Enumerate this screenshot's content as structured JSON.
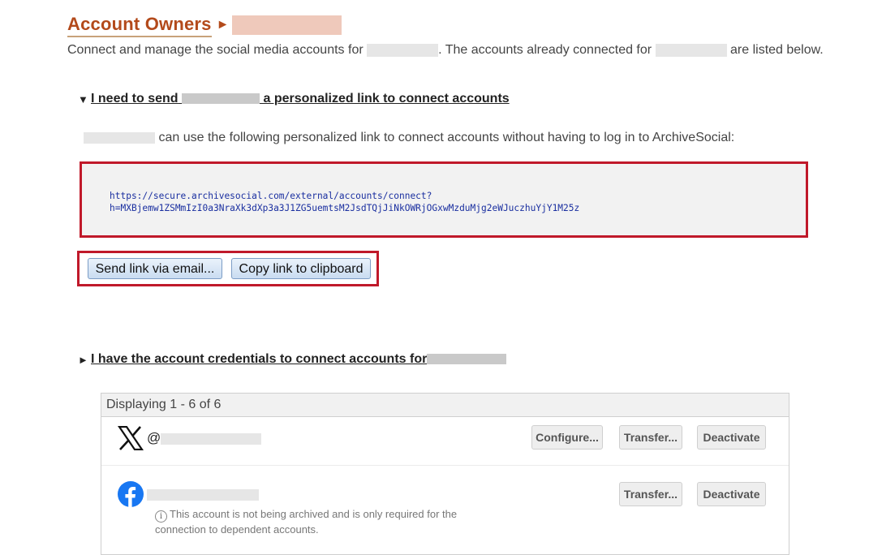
{
  "header": {
    "title": "Account Owners",
    "arrow": "►"
  },
  "intro": {
    "prefix": "Connect and manage the social media accounts for",
    "middle": ". The accounts already connected for",
    "suffix": "are listed below."
  },
  "personalized_section": {
    "toggle_icon": "▼",
    "label_prefix": "I need to send",
    "label_suffix": "a personalized link to connect accounts",
    "description": "can use the following personalized link to connect accounts without having to log in to ArchiveSocial:",
    "url_line1": "https://secure.archivesocial.com/external/accounts/connect?",
    "url_line2": "h=MXBjemw1ZSMmIzI0a3NraXk3dXp3a3J1ZG5uemtsM2JsdTQjJiNkOWRjOGxwMzduMjg2eWJuczhuYjY1M25z",
    "send_email_label": "Send link via email...",
    "copy_clipboard_label": "Copy link to clipboard"
  },
  "credentials_section": {
    "toggle_icon": "►",
    "label_prefix": "I have the account credentials to connect accounts for"
  },
  "accounts_panel": {
    "displaying": "Displaying 1 - 6 of 6",
    "rows": [
      {
        "network_icon": "x-logo-icon",
        "handle_prefix": "@",
        "configure_label": "Configure...",
        "transfer_label": "Transfer...",
        "deactivate_label": "Deactivate"
      },
      {
        "network_icon": "facebook-logo-icon",
        "transfer_label": "Transfer...",
        "deactivate_label": "Deactivate",
        "info_icon": "ⓘ",
        "note": "This account is not being archived and is only required for the connection to dependent accounts."
      }
    ]
  },
  "colors": {
    "title": "#b34a1b",
    "highlight_border": "#c0192a",
    "url_text": "#1a2fa0",
    "facebook": "#1877f2"
  }
}
